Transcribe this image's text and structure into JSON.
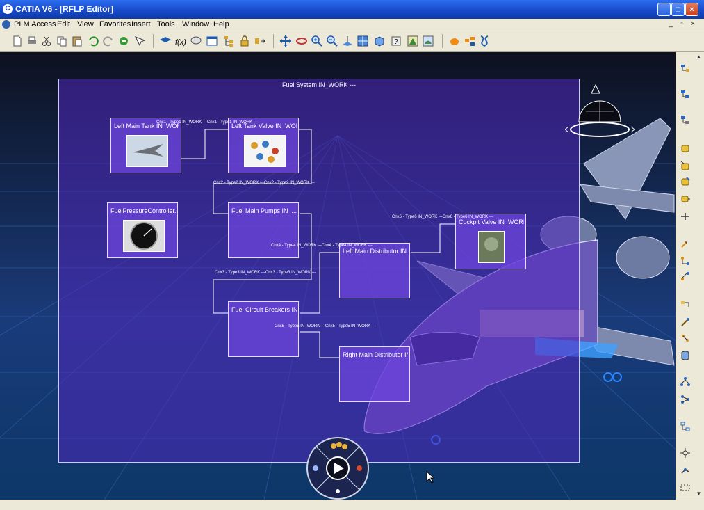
{
  "window": {
    "title": "CATIA V6 - [RFLP Editor]",
    "controls": [
      "_",
      "□",
      "×"
    ]
  },
  "menu": {
    "items": [
      "PLM Access",
      "Edit",
      "View",
      "Favorites",
      "Insert",
      "Tools",
      "Window",
      "Help"
    ],
    "doc_controls": [
      "_",
      "▫",
      "×"
    ]
  },
  "diagram": {
    "title": "Fuel System IN_WORK ---",
    "nodes": [
      {
        "label": "Left Main Tank IN_WOR...",
        "thumb": "jet-fighter"
      },
      {
        "label": "Left Tank Valve IN_WOR...",
        "thumb": "valves"
      },
      {
        "label": "FuelPressureController....",
        "thumb": "gauge"
      },
      {
        "label": "Fuel Main Pumps IN_...",
        "thumb": ""
      },
      {
        "label": "Left Main Distributor IN...",
        "thumb": ""
      },
      {
        "label": "Cockpit Valve IN_WORK...",
        "thumb": "pilot"
      },
      {
        "label": "Fuel Circuit Breakers IN...",
        "thumb": ""
      },
      {
        "label": "Right Main Distributor IN...",
        "thumb": ""
      }
    ],
    "connections": [
      "Cnx1 - Type1 IN_WORK ---Cnx1 - Type1 IN_WORK ---",
      "Cnx2 - Type2 IN_WORK ---Cnx2 - Type2 IN_WORK ---",
      "Cnx4 - Type4 IN_WORK ---Cnx4 - Type4 IN_WORK ---",
      "Cnx3 - Type3 IN_WORK ---Cnx3 - Type3 IN_WORK ---",
      "Cnx5 - Type5 IN_WORK ---Cnx5 - Type5 IN_WORK ---",
      "Cnx6 - Type6 IN_WORK ---Cnx6 - Type6 IN_WORK ---"
    ]
  },
  "colors": {
    "title_bar": "#1648c8",
    "diagram_fill": "#5028be",
    "viewport_bg": "#142a55"
  }
}
